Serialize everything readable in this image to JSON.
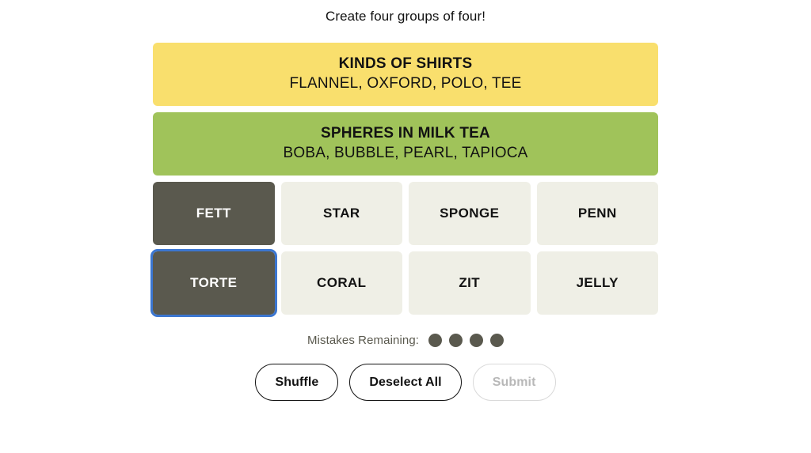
{
  "game": {
    "instruction": "Create four groups of four!",
    "colors": {
      "yellow": "#f9df6d",
      "green": "#a0c35a",
      "selected_tile": "#5a594e",
      "unselected_tile": "#efefe6",
      "focus_ring": "#3b76d0",
      "text": "#121212"
    },
    "solved_groups": [
      {
        "title": "KINDS OF SHIRTS",
        "words": "FLANNEL, OXFORD, POLO, TEE",
        "color": "#f9df6d",
        "color_name": "yellow"
      },
      {
        "title": "SPHERES IN MILK TEA",
        "words": "BOBA, BUBBLE, PEARL, TAPIOCA",
        "color": "#a0c35a",
        "color_name": "green"
      }
    ],
    "tile_rows": [
      [
        {
          "label": "FETT",
          "selected": true,
          "focused": false
        },
        {
          "label": "STAR",
          "selected": false,
          "focused": false
        },
        {
          "label": "SPONGE",
          "selected": false,
          "focused": false
        },
        {
          "label": "PENN",
          "selected": false,
          "focused": false
        }
      ],
      [
        {
          "label": "TORTE",
          "selected": true,
          "focused": true
        },
        {
          "label": "CORAL",
          "selected": false,
          "focused": false
        },
        {
          "label": "ZIT",
          "selected": false,
          "focused": false
        },
        {
          "label": "JELLY",
          "selected": false,
          "focused": false
        }
      ]
    ],
    "mistakes": {
      "label": "Mistakes Remaining:",
      "remaining": 4
    },
    "buttons": [
      {
        "label": "Shuffle",
        "name": "shuffle-button",
        "disabled": false
      },
      {
        "label": "Deselect All",
        "name": "deselect-all-button",
        "disabled": false
      },
      {
        "label": "Submit",
        "name": "submit-button",
        "disabled": true
      }
    ]
  }
}
